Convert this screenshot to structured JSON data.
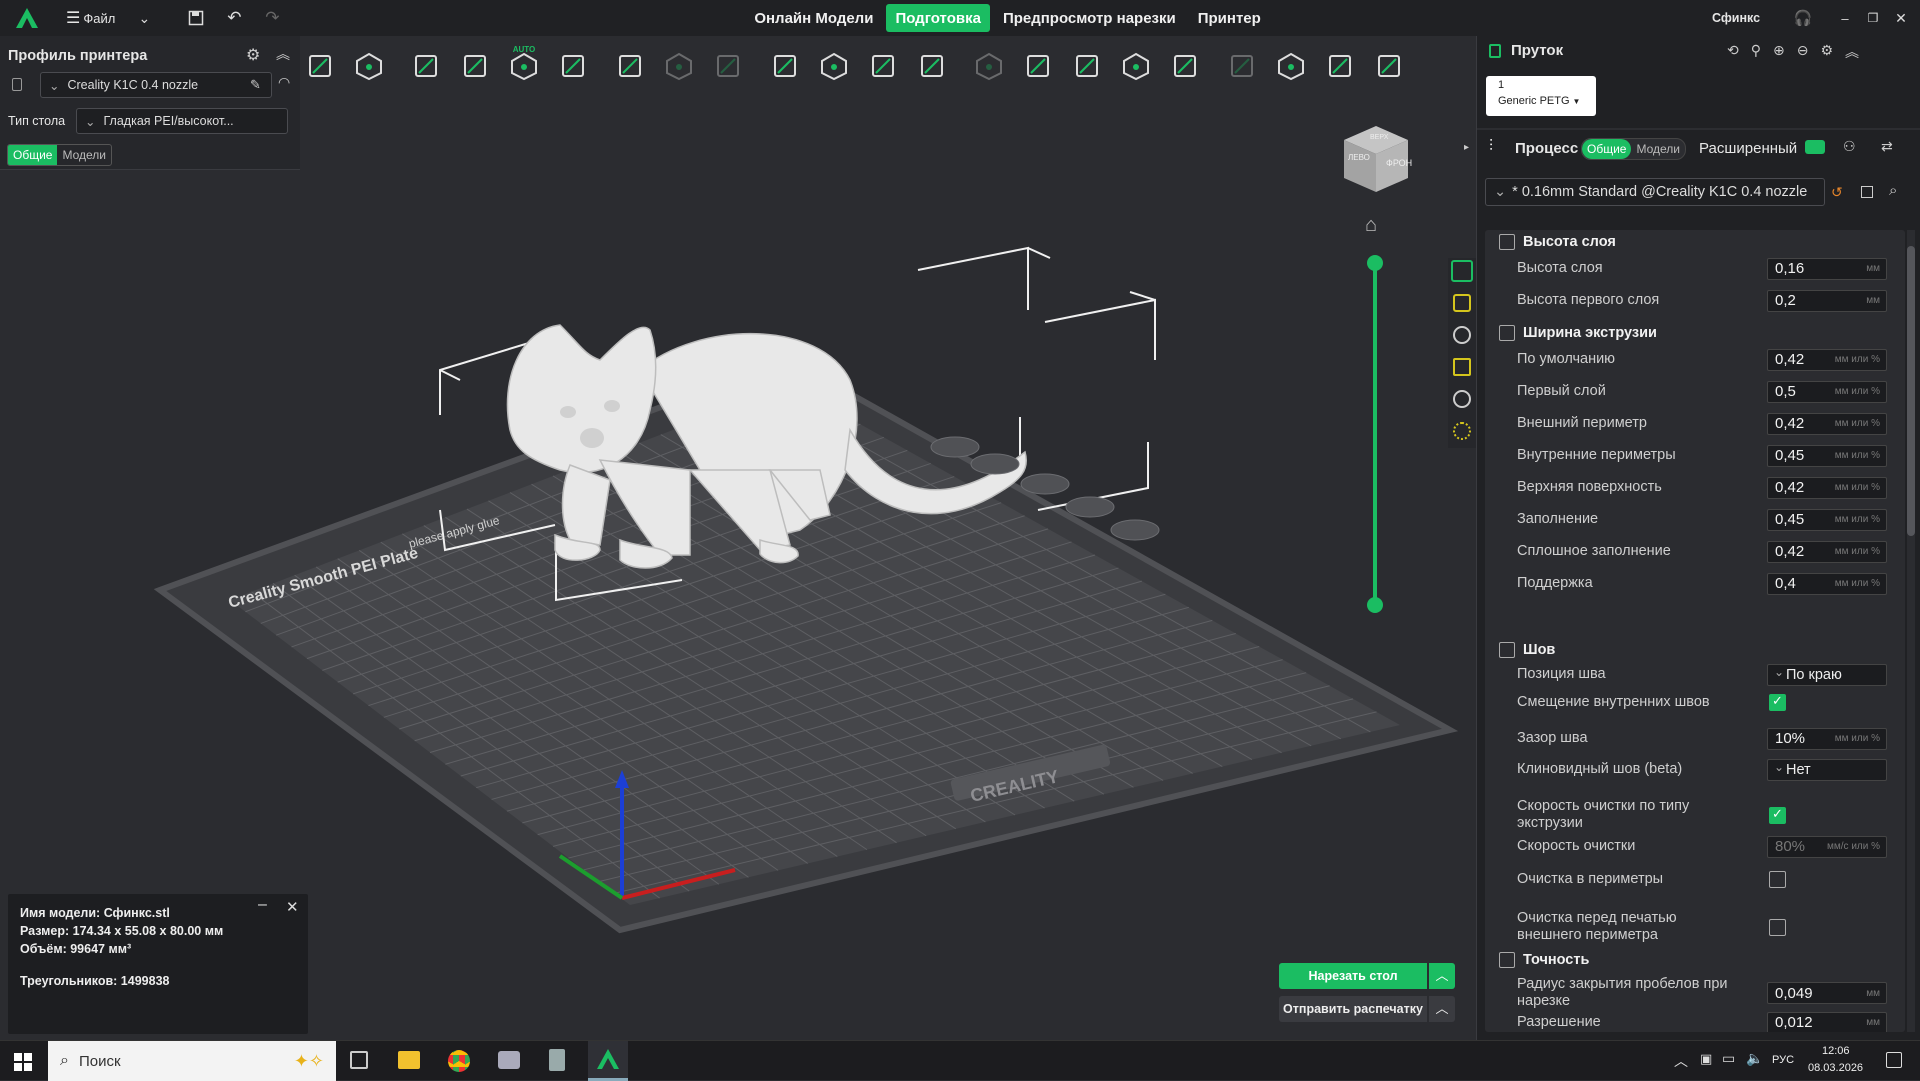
{
  "topbar": {
    "file_label": "Файл",
    "tabs": [
      "Онлайн Модели",
      "Подготовка",
      "Предпросмотр нарезки",
      "Принтер"
    ],
    "active_tab": 1,
    "project_name": "Сфинкс"
  },
  "toolbar": {
    "auto_label": "AUTO"
  },
  "printer": {
    "title": "Профиль принтера",
    "profile": "Creality K1C 0.4 nozzle",
    "bed_label": "Тип стола",
    "bed_value": "Гладкая PEI/высокот...",
    "tab_general": "Общие",
    "tab_models": "Модели"
  },
  "filament": {
    "title": "Пруток",
    "slot": "1",
    "name": "Generic PETG"
  },
  "process": {
    "title": "Процесс",
    "tab_general": "Общие",
    "tab_models": "Модели",
    "advanced": "Расширенный",
    "preset": "* 0.16mm Standard @Creality K1C 0.4 nozzle"
  },
  "settings": {
    "layer": {
      "title": "Высота слоя",
      "rows": [
        {
          "label": "Высота слоя",
          "value": "0,16",
          "unit": "мм"
        },
        {
          "label": "Высота первого слоя",
          "value": "0,2",
          "unit": "мм"
        }
      ]
    },
    "width": {
      "title": "Ширина экструзии",
      "rows": [
        {
          "label": "По умолчанию",
          "value": "0,42",
          "unit": "мм или %"
        },
        {
          "label": "Первый слой",
          "value": "0,5",
          "unit": "мм или %"
        },
        {
          "label": "Внешний периметр",
          "value": "0,42",
          "unit": "мм или %"
        },
        {
          "label": "Внутренние периметры",
          "value": "0,45",
          "unit": "мм или %"
        },
        {
          "label": "Верхняя поверхность",
          "value": "0,42",
          "unit": "мм или %"
        },
        {
          "label": "Заполнение",
          "value": "0,45",
          "unit": "мм или %"
        },
        {
          "label": "Сплошное заполнение",
          "value": "0,42",
          "unit": "мм или %"
        },
        {
          "label": "Поддержка",
          "value": "0,4",
          "unit": "мм или %"
        }
      ]
    },
    "seam": {
      "title": "Шов",
      "position_label": "Позиция шва",
      "position_value": "По краю",
      "offset_label": "Смещение внутренних швов",
      "gap_label": "Зазор шва",
      "gap_value": "10%",
      "gap_unit": "мм или %",
      "scarf_label": "Клиновидный шов (beta)",
      "scarf_value": "Нет",
      "wipe_speed_type_label": "Скорость очистки по типу экструзии",
      "wipe_speed_label": "Скорость очистки",
      "wipe_speed_value": "80%",
      "wipe_speed_unit": "мм/с или %",
      "wipe_perim_label": "Очистка в периметры",
      "wipe_before_label": "Очистка перед печатью внешнего периметра"
    },
    "precision": {
      "title": "Точность",
      "gap_close_label": "Радиус закрытия пробелов при нарезке",
      "gap_close_value": "0,049",
      "gap_close_unit": "мм",
      "resolution_label": "Разрешение",
      "resolution_value": "0,012",
      "resolution_unit": "мм"
    }
  },
  "viewport": {
    "cube_front": "ФРОНТ",
    "cube_left": "ЛЕВО",
    "cube_top": "ВЕРХ",
    "plate_name": "Creality Smooth PEI Plate",
    "plate_hint": "please apply glue",
    "plate_brand": "CREALITY"
  },
  "model_info": {
    "name": "Имя модели: Сфинкс.stl",
    "size": "Размер: 174.34 x 55.08 x 80.00 мм",
    "volume": "Объём: 99647 мм³",
    "triangles": "Треугольников: 1499838"
  },
  "actions": {
    "slice": "Нарезать стол",
    "send": "Отправить распечатку"
  },
  "taskbar": {
    "search": "Поиск",
    "lang": "РУС",
    "time": "12:06",
    "date": "08.03.2026"
  },
  "colors": {
    "accent": "#1bbd62",
    "panel": "#202124",
    "bg": "#2b2c30"
  }
}
